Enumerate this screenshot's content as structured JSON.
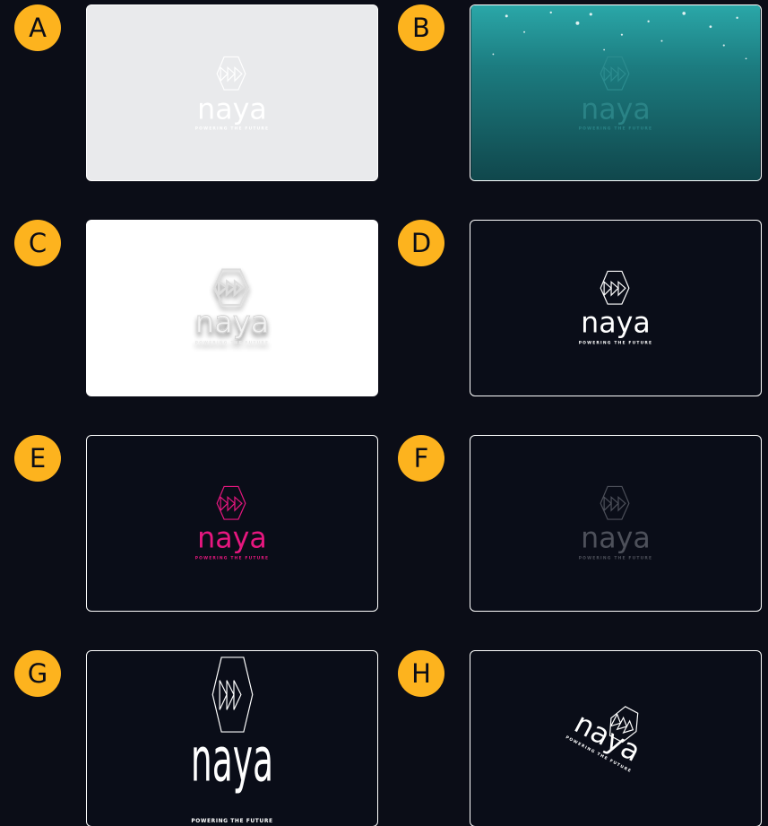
{
  "options": [
    {
      "letter": "A",
      "variant": "light-grey-background",
      "wordmark": "naya",
      "tagline": "POWERING THE FUTURE"
    },
    {
      "letter": "B",
      "variant": "underwater-photo-background",
      "wordmark": "naya",
      "tagline": "POWERING THE FUTURE"
    },
    {
      "letter": "C",
      "variant": "white-embossed",
      "wordmark": "naya",
      "tagline": "POWERING THE FUTURE"
    },
    {
      "letter": "D",
      "variant": "white-on-navy",
      "wordmark": "naya",
      "tagline": "POWERING THE FUTURE"
    },
    {
      "letter": "E",
      "variant": "pink-on-navy",
      "wordmark": "naya",
      "tagline": "POWERING THE FUTURE"
    },
    {
      "letter": "F",
      "variant": "grey-on-navy",
      "wordmark": "naya",
      "tagline": "POWERING THE FUTURE"
    },
    {
      "letter": "G",
      "variant": "tall-stretched-white-on-navy",
      "wordmark": "naya",
      "tagline": "POWERING THE FUTURE"
    },
    {
      "letter": "H",
      "variant": "rotated-white-on-navy",
      "wordmark": "naya",
      "tagline": "POWERING THE FUTURE"
    }
  ],
  "colors": {
    "page_background": "#0b0d17",
    "badge": "#fdb31e",
    "card_border": "#ffffff",
    "navy": "#0a0d18",
    "light_grey": "#e9eaec",
    "pink": "#e6177f",
    "muted_grey": "#4d505a",
    "ocean_teal": "#1a6f73"
  },
  "icons": {
    "logo_mark": "hexagon-with-three-triangles-icon"
  }
}
